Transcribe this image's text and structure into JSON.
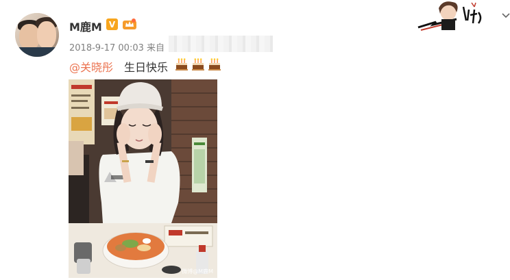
{
  "post": {
    "username": "M鹿M",
    "verified_badge": "V",
    "timestamp": "2018-9-17 00:03",
    "source_prefix": "来自",
    "mention": "@关晓彤",
    "text": "生日快乐",
    "cake_emoji_count": 3,
    "photo_watermark": "微博@M鹿M"
  },
  "colors": {
    "mention": "#eb7350",
    "badge": "#f7a51d",
    "meta": "#808080"
  },
  "icons": [
    "verified-v-icon",
    "crown-badge-icon",
    "cake-emoji-icon",
    "chevron-down-icon"
  ]
}
